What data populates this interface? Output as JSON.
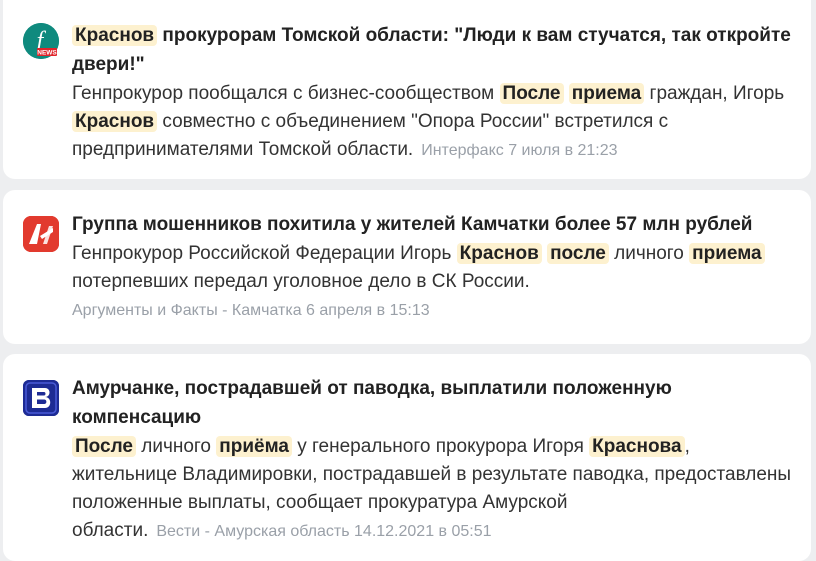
{
  "colors": {
    "page_background": "#edeef0",
    "card_background": "#ffffff",
    "highlight": "#fdf1cf",
    "meta_text": "#9aa0a8",
    "logo_interfax": "#0f8a7e",
    "logo_aif": "#e23a2e",
    "logo_vesti": "#1d2b94"
  },
  "items": [
    {
      "logo_icon": "interfax-logo-icon",
      "logo_badge": "NEWS",
      "title": [
        {
          "text": "Краснов",
          "hl": true
        },
        {
          "text": " прокурорам Томской области: \"Люди к вам стучатся, так откройте двери!\"",
          "hl": false
        }
      ],
      "snippet": [
        {
          "text": "Генпрокурор пообщался с бизнес-сообществом ",
          "hl": false
        },
        {
          "text": "После",
          "hl": true
        },
        {
          "text": " ",
          "hl": false
        },
        {
          "text": "приема",
          "hl": true
        },
        {
          "text": " граждан, Игорь ",
          "hl": false
        },
        {
          "text": "Краснов",
          "hl": true
        },
        {
          "text": " совместно с объединением \"Опора России\" встретился с предпринимателями Томской области.",
          "hl": false
        }
      ],
      "meta": "Интерфакс 7 июля в 21:23"
    },
    {
      "logo_icon": "aif-logo-icon",
      "title": [
        {
          "text": "Группа мошенников похитила у жителей Камчатки более 57 млн рублей",
          "hl": false
        }
      ],
      "snippet": [
        {
          "text": "Генпрокурор Российской Федерации Игорь ",
          "hl": false
        },
        {
          "text": "Краснов",
          "hl": true
        },
        {
          "text": " ",
          "hl": false
        },
        {
          "text": "после",
          "hl": true
        },
        {
          "text": " личного ",
          "hl": false
        },
        {
          "text": "приема",
          "hl": true
        },
        {
          "text": " потерпевших передал уголовное дело в СК России.",
          "hl": false
        }
      ],
      "meta": "Аргументы и Факты - Камчатка 6 апреля в 15:13"
    },
    {
      "logo_icon": "vesti-logo-icon",
      "title": [
        {
          "text": "Амурчанке, пострадавшей от паводка, выплатили положенную компенсацию",
          "hl": false
        }
      ],
      "snippet": [
        {
          "text": "После",
          "hl": true
        },
        {
          "text": " личного ",
          "hl": false
        },
        {
          "text": "приёма",
          "hl": true
        },
        {
          "text": " у генерального прокурора Игоря ",
          "hl": false
        },
        {
          "text": "Краснова",
          "hl": true
        },
        {
          "text": ", жительнице Владимировки, пострадавшей в результате паводка, предоставлены положенные выплаты, сообщает прокуратура Амурской области.",
          "hl": false
        }
      ],
      "meta": "Вести - Амурская область 14.12.2021 в 05:51"
    }
  ]
}
